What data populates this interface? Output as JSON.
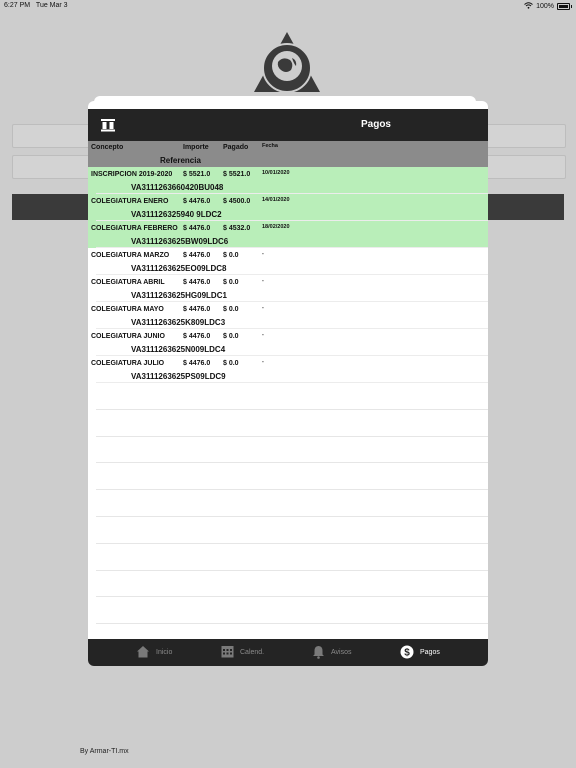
{
  "status_bar": {
    "time": "6:27 PM",
    "date": "Tue Mar 3",
    "battery": "100%",
    "wifi_icon": "wifi-icon"
  },
  "background": {
    "credit": "By Armar-TI.mx"
  },
  "modal": {
    "title": "Pagos",
    "header_icon": "pillars-icon",
    "columns": {
      "concepto": "Concepto",
      "importe": "Importe",
      "pagado": "Pagado",
      "fecha": "Fecha",
      "referencia": "Referencia"
    },
    "rows": [
      {
        "concepto": "INSCRIPCION 2019-2020",
        "importe": "$ 5521.0",
        "pagado": "$ 5521.0",
        "fecha": "10/01/2020",
        "referencia": "VA3111263660420BU048",
        "paid": true
      },
      {
        "concepto": "COLEGIATURA ENERO",
        "importe": "$ 4476.0",
        "pagado": "$ 4500.0",
        "fecha": "14/01/2020",
        "referencia": "VA311126325940 9LDC2",
        "paid": true
      },
      {
        "concepto": "COLEGIATURA FEBRERO",
        "importe": "$ 4476.0",
        "pagado": "$ 4532.0",
        "fecha": "18/02/2020",
        "referencia": "VA3111263625BW09LDC6",
        "paid": true
      },
      {
        "concepto": "COLEGIATURA  MARZO",
        "importe": "$ 4476.0",
        "pagado": "$ 0.0",
        "fecha": "-",
        "referencia": "VA3111263625EO09LDC8",
        "paid": false
      },
      {
        "concepto": "COLEGIATURA  ABRIL",
        "importe": "$ 4476.0",
        "pagado": "$ 0.0",
        "fecha": "-",
        "referencia": "VA3111263625HG09LDC1",
        "paid": false
      },
      {
        "concepto": "COLEGIATURA MAYO",
        "importe": "$ 4476.0",
        "pagado": "$ 0.0",
        "fecha": "-",
        "referencia": "VA3111263625K809LDC3",
        "paid": false
      },
      {
        "concepto": "COLEGIATURA  JUNIO",
        "importe": "$ 4476.0",
        "pagado": "$ 0.0",
        "fecha": "-",
        "referencia": "VA3111263625N009LDC4",
        "paid": false
      },
      {
        "concepto": "COLEGIATURA  JULIO",
        "importe": "$ 4476.0",
        "pagado": "$ 0.0",
        "fecha": "-",
        "referencia": "VA3111263625PS09LDC9",
        "paid": false
      }
    ],
    "paid_color": "#b9eeb9",
    "tabs": [
      {
        "label": "Inicio",
        "icon": "home-icon",
        "active": false
      },
      {
        "label": "Calend.",
        "icon": "calendar-icon",
        "active": false
      },
      {
        "label": "Avisos",
        "icon": "bell-icon",
        "active": false
      },
      {
        "label": "Pagos",
        "icon": "dollar-icon",
        "active": true
      }
    ]
  }
}
